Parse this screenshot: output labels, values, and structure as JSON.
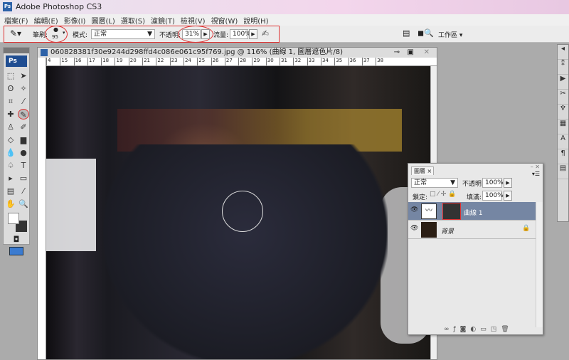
{
  "app": {
    "title": "Adobe Photoshop CS3",
    "logo": "Ps"
  },
  "menu": [
    "檔案(F)",
    "編輯(E)",
    "影像(I)",
    "圖層(L)",
    "選取(S)",
    "濾鏡(T)",
    "檢視(V)",
    "視窗(W)",
    "說明(H)"
  ],
  "options": {
    "brush_label": "筆刷:",
    "brush_size": "95",
    "mode_label": "模式:",
    "mode_value": "正常",
    "opacity_label": "不透明:",
    "opacity_value": "31%",
    "flow_label": "流量:",
    "flow_value": "100%",
    "workspace_label": "工作區 ▾"
  },
  "document": {
    "title": "060828381f30e9244d298ffd4c086e061c95f769.jpg @ 116% (曲線 1, 圖層遮色片/8)",
    "ruler_ticks": [
      "4",
      "15",
      "16",
      "17",
      "18",
      "19",
      "20",
      "21",
      "22",
      "23",
      "24",
      "25",
      "26",
      "27",
      "28",
      "29",
      "30",
      "31",
      "32",
      "33",
      "34",
      "35",
      "36",
      "37",
      "38"
    ]
  },
  "layers_panel": {
    "tab": "圖層",
    "blend_mode": "正常",
    "opacity_label": "不透明:",
    "opacity_value": "100%",
    "lock_label": "鎖定:",
    "fill_label": "填滿:",
    "fill_value": "100%",
    "layers": [
      {
        "name": "曲線 1",
        "selected": true
      },
      {
        "name": "背景",
        "locked": true
      }
    ]
  },
  "colors": {
    "accent": "#1f4d91",
    "selected_layer": "#7586a3",
    "highlight": "#d33333"
  }
}
